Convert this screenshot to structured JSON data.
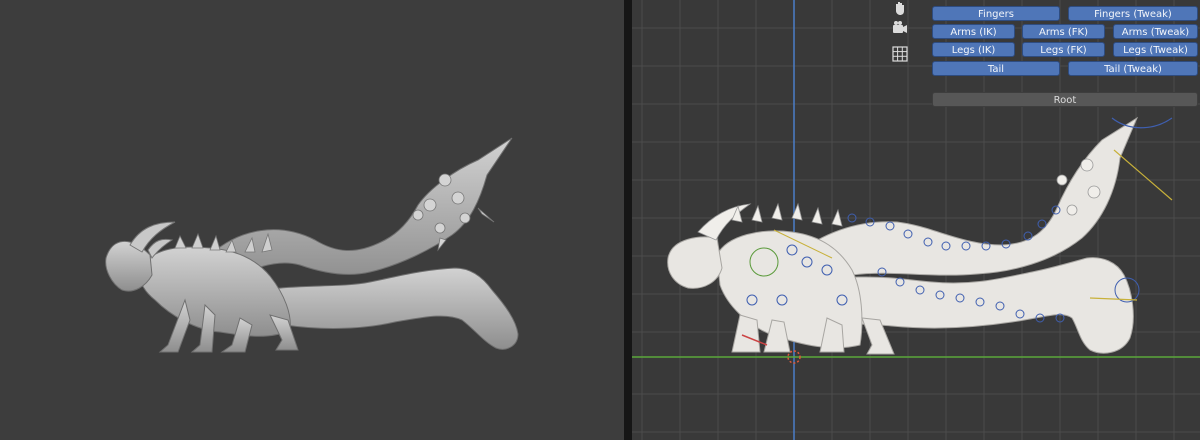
{
  "left_viewport": {
    "label": ""
  },
  "right_viewport": {
    "tools": [
      {
        "icon": "hand-pan-icon"
      },
      {
        "icon": "camera-icon"
      },
      {
        "icon": "grid-ortho-icon"
      }
    ]
  },
  "rig_layers": {
    "rows": [
      [
        "Fingers",
        "Fingers (Tweak)"
      ],
      [
        "Arms (IK)",
        "Arms (FK)",
        "Arms (Tweak)"
      ],
      [
        "Legs (IK)",
        "Legs (FK)",
        "Legs (Tweak)"
      ],
      [
        "Tail",
        "Tail (Tweak)"
      ],
      [
        "Root"
      ]
    ]
  },
  "colors": {
    "button_blue": "#4f76b8",
    "button_root": "#575757",
    "axis_x": "#5aa83a",
    "axis_z": "#4a7dc8",
    "mesh_sculpt": "#b4b4b4",
    "mesh_rig": "#e8e6e2"
  }
}
